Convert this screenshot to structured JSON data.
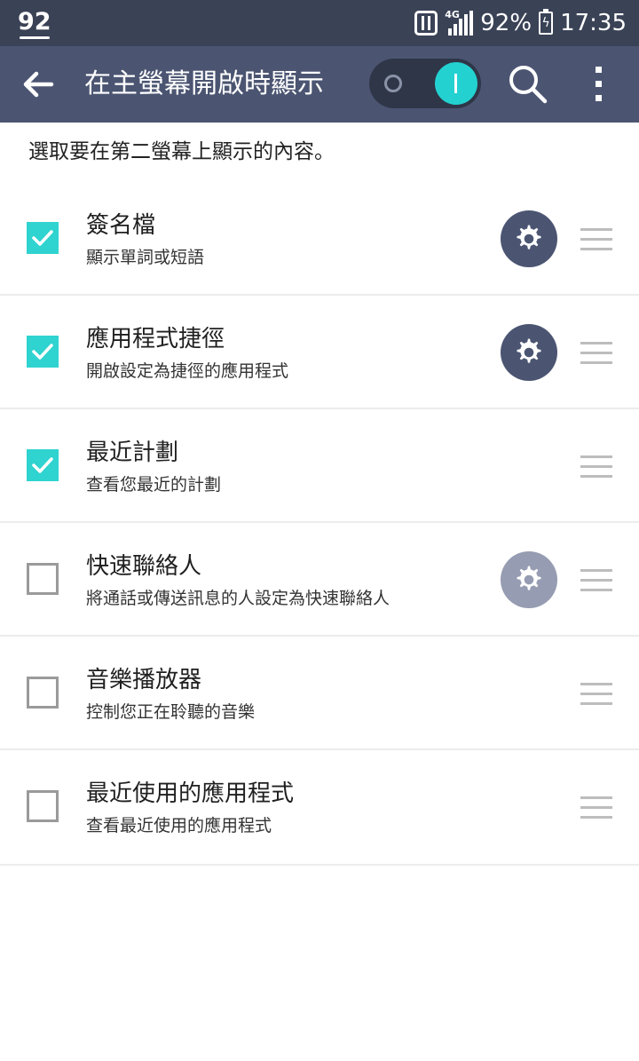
{
  "status_bar": {
    "left_indicator": "92",
    "network": "4G",
    "battery_percent": "92%",
    "time": "17:35"
  },
  "app_bar": {
    "title": "在主螢幕開啟時顯示",
    "toggle_on": true
  },
  "intro_text": "選取要在第二螢幕上顯示的內容。",
  "items": [
    {
      "title": "簽名檔",
      "subtitle": "顯示單詞或短語",
      "checked": true,
      "has_settings": true,
      "settings_enabled": true
    },
    {
      "title": "應用程式捷徑",
      "subtitle": "開啟設定為捷徑的應用程式",
      "checked": true,
      "has_settings": true,
      "settings_enabled": true
    },
    {
      "title": "最近計劃",
      "subtitle": "查看您最近的計劃",
      "checked": true,
      "has_settings": false
    },
    {
      "title": "快速聯絡人",
      "subtitle": "將通話或傳送訊息的人設定為快速聯絡人",
      "checked": false,
      "has_settings": true,
      "settings_enabled": false
    },
    {
      "title": "音樂播放器",
      "subtitle": "控制您正在聆聽的音樂",
      "checked": false,
      "has_settings": false
    },
    {
      "title": "最近使用的應用程式",
      "subtitle": "查看最近使用的應用程式",
      "checked": false,
      "has_settings": false
    }
  ],
  "colors": {
    "status_bar": "#3a4256",
    "app_bar": "#4b5572",
    "accent_teal": "#2fd3cf",
    "settings_disabled": "#969cb1"
  }
}
